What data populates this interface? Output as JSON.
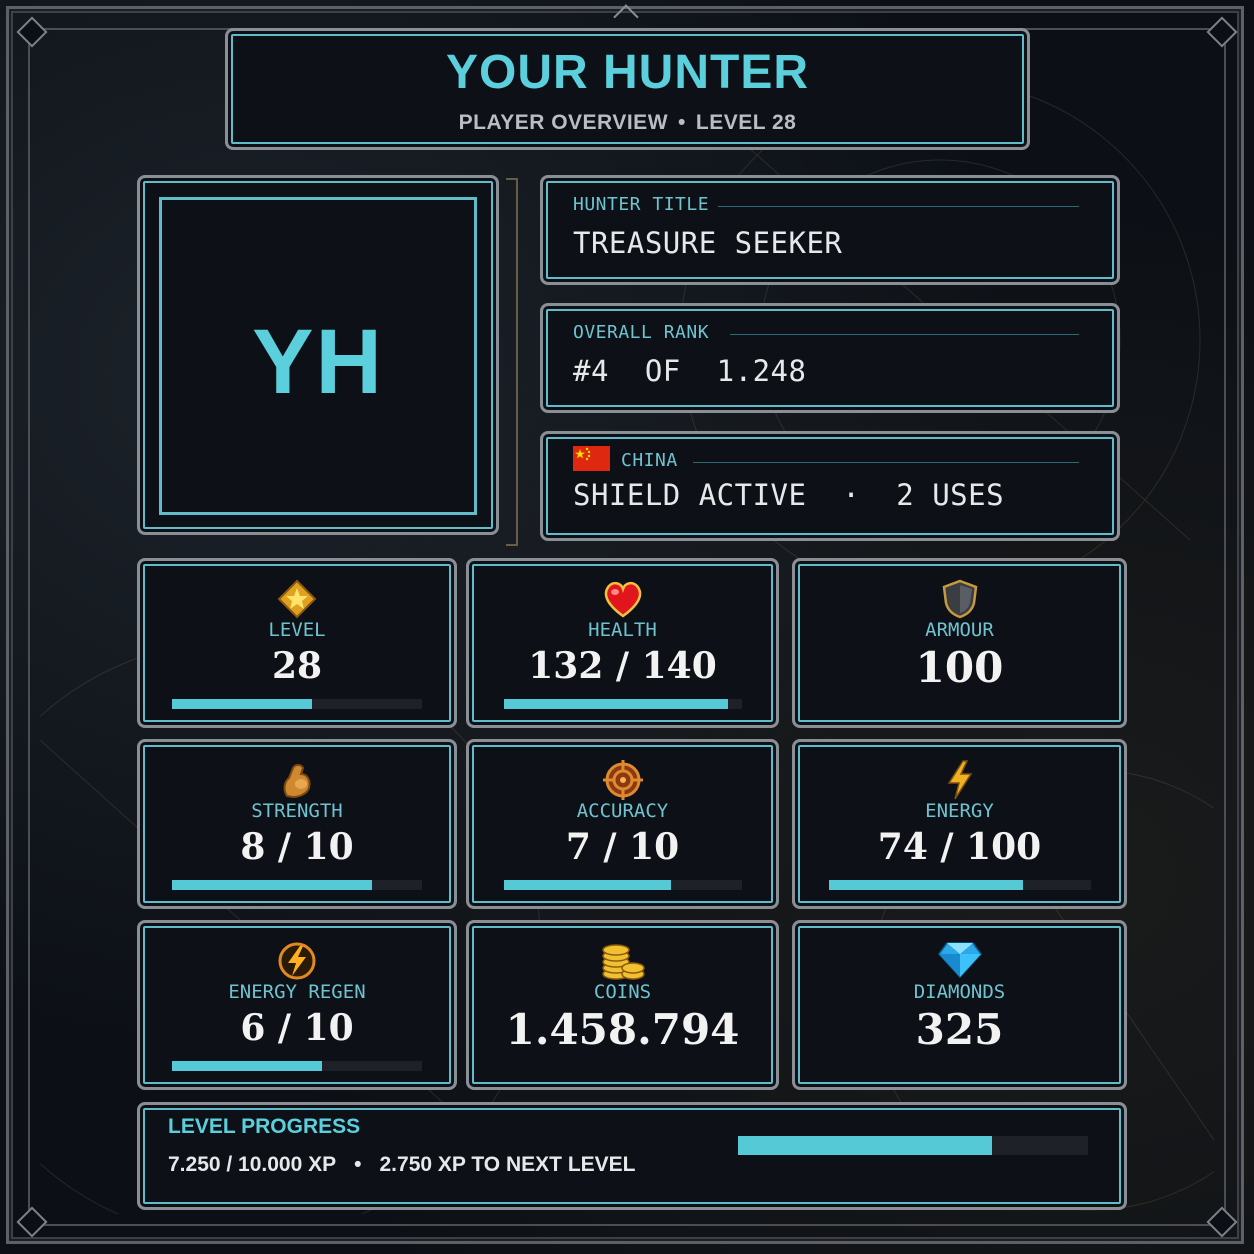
{
  "header": {
    "title": "YOUR HUNTER",
    "subtitle_left": "PLAYER OVERVIEW",
    "subtitle_separator": "•",
    "subtitle_right": "LEVEL 28"
  },
  "avatar": {
    "initials": "YH"
  },
  "hunter_title": {
    "label": "HUNTER TITLE",
    "value": "TREASURE SEEKER"
  },
  "overall_rank": {
    "label": "OVERALL RANK",
    "value": "#4  OF  1.248"
  },
  "country": {
    "label": "CHINA",
    "flag": "china-flag",
    "status": "SHIELD ACTIVE  ·  2 USES"
  },
  "stats": {
    "level": {
      "label": "LEVEL",
      "value": "28",
      "icon": "star-badge-icon",
      "progress": 0.56
    },
    "health": {
      "label": "HEALTH",
      "value": "132 / 140",
      "icon": "heart-icon",
      "progress": 0.94
    },
    "armour": {
      "label": "ARMOUR",
      "value": "100",
      "icon": "shield-icon"
    },
    "strength": {
      "label": "STRENGTH",
      "value": "8 / 10",
      "icon": "flexed-arm-icon",
      "progress": 0.8
    },
    "accuracy": {
      "label": "ACCURACY",
      "value": "7 / 10",
      "icon": "crosshair-icon",
      "progress": 0.7
    },
    "energy": {
      "label": "ENERGY",
      "value": "74 / 100",
      "icon": "lightning-icon",
      "progress": 0.74
    },
    "energy_regen": {
      "label": "ENERGY REGEN",
      "value": "6 / 10",
      "icon": "lightning-circle-icon",
      "progress": 0.6
    },
    "coins": {
      "label": "COINS",
      "value": "1.458.794",
      "icon": "coins-icon"
    },
    "diamonds": {
      "label": "DIAMONDS",
      "value": "325",
      "icon": "diamond-icon"
    }
  },
  "level_progress": {
    "label": "LEVEL PROGRESS",
    "xp": "7.250 / 10.000 XP",
    "separator": "•",
    "to_next": "2.750 XP TO NEXT LEVEL",
    "progress": 0.725
  },
  "colors": {
    "accent": "#56c9d6",
    "frame": "#8a8f96",
    "background": "#0d1016"
  }
}
